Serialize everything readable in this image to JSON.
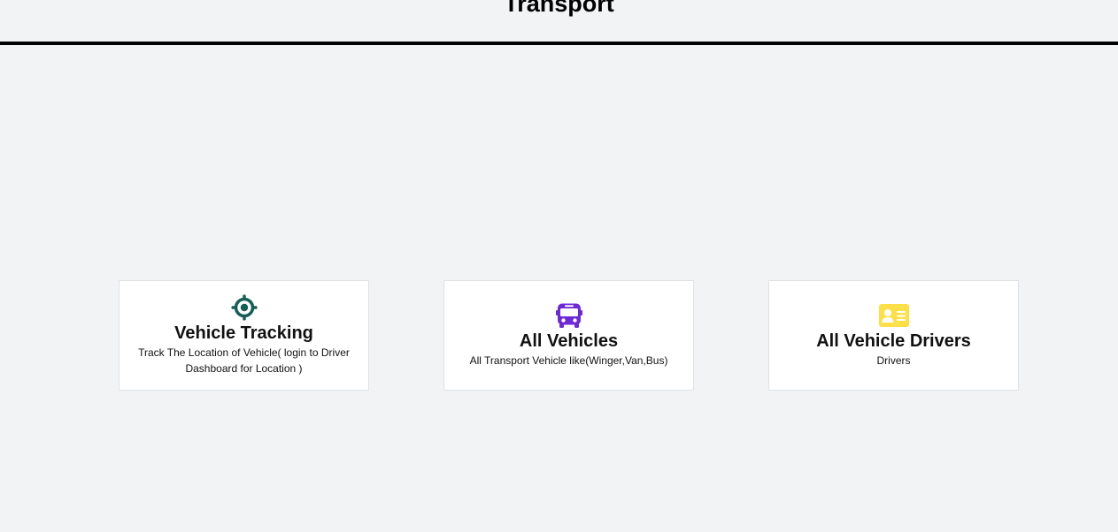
{
  "header": {
    "title": "Transport"
  },
  "cards": [
    {
      "title": "Vehicle Tracking",
      "description": "Track The Location of Vehicle( login to Driver Dashboard for Location )",
      "icon": "location-crosshair-icon",
      "icon_color": "#155e56"
    },
    {
      "title": "All Vehicles",
      "description": "All Transport Vehicle like(Winger,Van,Bus)",
      "icon": "bus-icon",
      "icon_color": "#6d28d9"
    },
    {
      "title": "All Vehicle Drivers",
      "description": "Drivers",
      "icon": "id-card-icon",
      "icon_color": "#fde047"
    }
  ],
  "colors": {
    "background": "#f2f3f5",
    "card_background": "#ffffff",
    "header_rule": "#000000"
  }
}
